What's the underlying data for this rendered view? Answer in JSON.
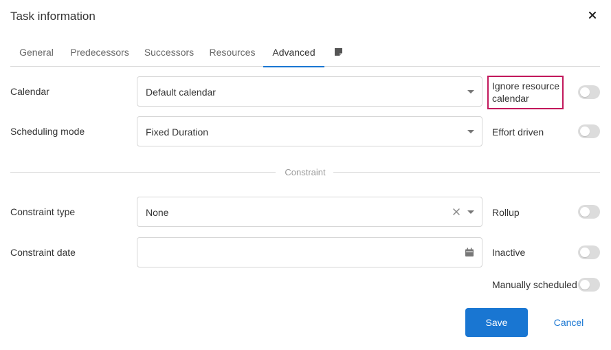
{
  "dialog": {
    "title": "Task information"
  },
  "tabs": [
    {
      "label": "General"
    },
    {
      "label": "Predecessors"
    },
    {
      "label": "Successors"
    },
    {
      "label": "Resources"
    },
    {
      "label": "Advanced",
      "active": true
    }
  ],
  "tab_icon": "note-icon",
  "fields": {
    "calendar": {
      "label": "Calendar",
      "value": "Default calendar"
    },
    "scheduling_mode": {
      "label": "Scheduling mode",
      "value": "Fixed Duration"
    },
    "constraint_type": {
      "label": "Constraint type",
      "value": "None"
    },
    "constraint_date": {
      "label": "Constraint date",
      "value": ""
    }
  },
  "divider": {
    "label": "Constraint"
  },
  "toggles": {
    "ignore_resource_calendar": {
      "line1": "Ignore resource",
      "line2": "calendar",
      "on": false
    },
    "effort_driven": {
      "label": "Effort driven",
      "on": false
    },
    "rollup": {
      "label": "Rollup",
      "on": false
    },
    "inactive": {
      "label": "Inactive",
      "on": false
    },
    "manually_scheduled": {
      "label": "Manually scheduled",
      "on": false
    }
  },
  "buttons": {
    "save": "Save",
    "cancel": "Cancel"
  },
  "colors": {
    "accent": "#1976d2",
    "highlight": "#c2185b",
    "toggle_off": "#dcdcdc"
  }
}
